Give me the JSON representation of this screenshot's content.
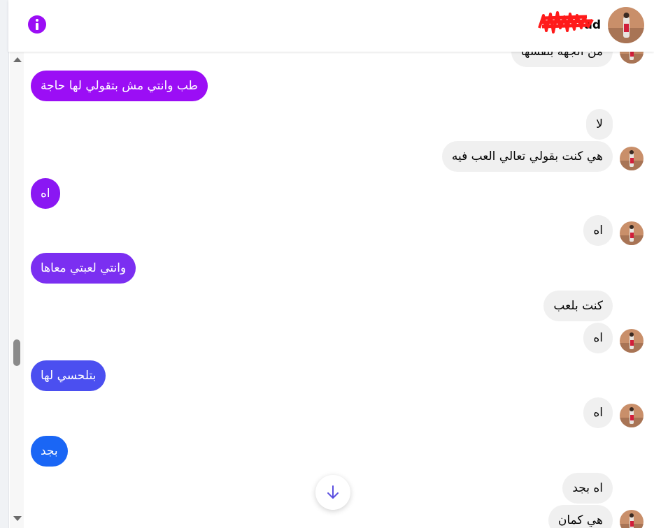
{
  "header": {
    "contact_name": "ad",
    "info_icon": "info-icon",
    "accent_color": "#9b0ef5"
  },
  "messages": [
    {
      "side": "received",
      "text": "من الجهة بنفسها",
      "avatar": true
    },
    {
      "side": "sent",
      "text": "طب وانتي مش بتقولي لها حاجة",
      "color": "#9b0ef5"
    },
    {
      "side": "received",
      "text": "لا",
      "avatar": false
    },
    {
      "side": "received",
      "text": "هي كنت بقولي تعالي العب فيه",
      "avatar": true
    },
    {
      "side": "sent",
      "text": "اه",
      "color": "#8a17f3"
    },
    {
      "side": "received",
      "text": "اه",
      "avatar": true
    },
    {
      "side": "sent",
      "text": "وانتي لعبتي معاها",
      "color": "#7b2ff1"
    },
    {
      "side": "received",
      "text": "كنت بلعب",
      "avatar": false
    },
    {
      "side": "received",
      "text": "اه",
      "avatar": true
    },
    {
      "side": "sent",
      "text": "بتلحسي لها",
      "color": "#4b4ff0"
    },
    {
      "side": "received",
      "text": "اه",
      "avatar": true
    },
    {
      "side": "sent",
      "text": "بجد",
      "color": "#1a66f5"
    },
    {
      "side": "received",
      "text": "اه بجد",
      "avatar": false
    },
    {
      "side": "received",
      "text": "هي كمان",
      "avatar": true
    }
  ],
  "scroll_to_bottom": {
    "icon": "arrow-down-icon"
  }
}
